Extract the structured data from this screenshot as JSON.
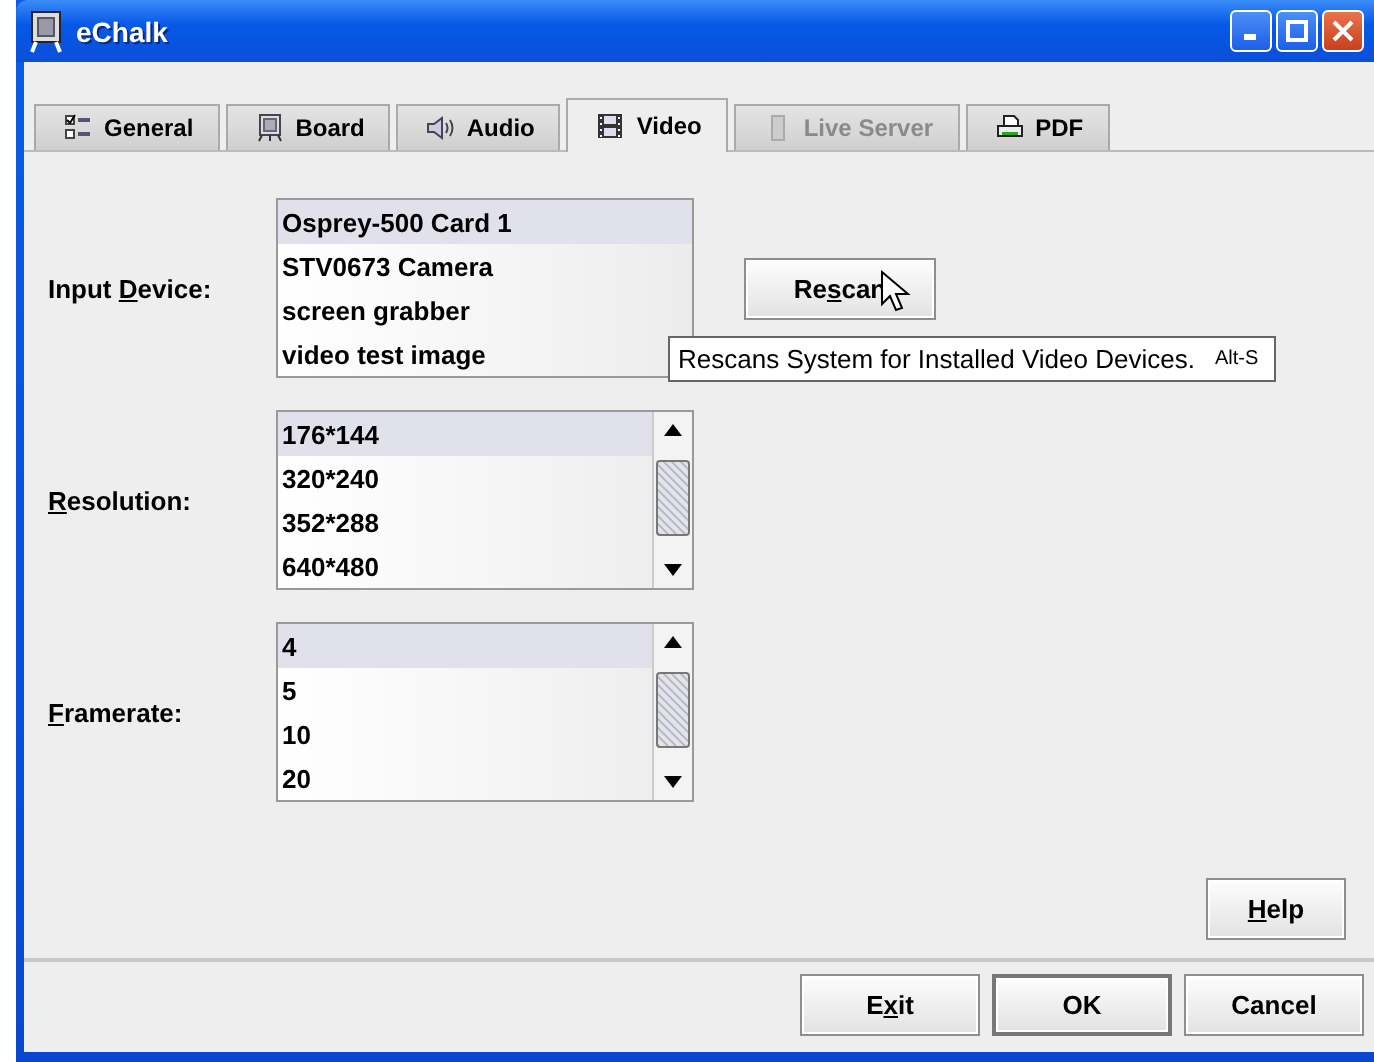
{
  "window": {
    "title": "eChalk"
  },
  "tabs": [
    {
      "label": "General",
      "kind": "checklist",
      "selected": false,
      "disabled": false
    },
    {
      "label": "Board",
      "kind": "board",
      "selected": false,
      "disabled": false
    },
    {
      "label": "Audio",
      "kind": "speaker",
      "selected": false,
      "disabled": false
    },
    {
      "label": "Video",
      "kind": "film",
      "selected": true,
      "disabled": false
    },
    {
      "label": "Live Server",
      "kind": "server",
      "selected": false,
      "disabled": true
    },
    {
      "label": "PDF",
      "kind": "printer",
      "selected": false,
      "disabled": false
    }
  ],
  "fields": [
    {
      "label": [
        {
          "text": "Input ",
          "underline": false
        },
        {
          "text": "D",
          "underline": true
        },
        {
          "text": "evice:",
          "underline": false
        }
      ],
      "scrollbar": false,
      "items": [
        {
          "text": "Osprey-500 Card 1",
          "selected": true
        },
        {
          "text": "STV0673 Camera",
          "selected": false
        },
        {
          "text": "screen grabber",
          "selected": false
        },
        {
          "text": "video test image",
          "selected": false
        }
      ]
    },
    {
      "label": [
        {
          "text": "R",
          "underline": true
        },
        {
          "text": "esolution:",
          "underline": false
        }
      ],
      "scrollbar": true,
      "items": [
        {
          "text": "176*144",
          "selected": true
        },
        {
          "text": "320*240",
          "selected": false
        },
        {
          "text": "352*288",
          "selected": false
        },
        {
          "text": "640*480",
          "selected": false
        }
      ]
    },
    {
      "label": [
        {
          "text": "F",
          "underline": true
        },
        {
          "text": "ramerate:",
          "underline": false
        }
      ],
      "scrollbar": true,
      "items": [
        {
          "text": "4",
          "selected": true
        },
        {
          "text": "5",
          "selected": false
        },
        {
          "text": "10",
          "selected": false
        },
        {
          "text": "20",
          "selected": false
        }
      ]
    }
  ],
  "rescan_button": {
    "label": [
      {
        "text": "Re",
        "underline": false
      },
      {
        "text": "s",
        "underline": true
      },
      {
        "text": "can",
        "underline": false
      }
    ]
  },
  "tooltip": {
    "text": "Rescans System for Installed Video Devices.",
    "shortcut": "Alt-S"
  },
  "help_button": {
    "label": [
      {
        "text": "H",
        "underline": true
      },
      {
        "text": "elp",
        "underline": false
      }
    ]
  },
  "buttons": [
    {
      "label": [
        {
          "text": "E",
          "underline": false
        },
        {
          "text": "x",
          "underline": true
        },
        {
          "text": "it",
          "underline": false
        }
      ],
      "default": false
    },
    {
      "label": [
        {
          "text": "OK",
          "underline": false
        }
      ],
      "default": true
    },
    {
      "label": [
        {
          "text": "Cancel",
          "underline": false
        }
      ],
      "default": false
    }
  ]
}
